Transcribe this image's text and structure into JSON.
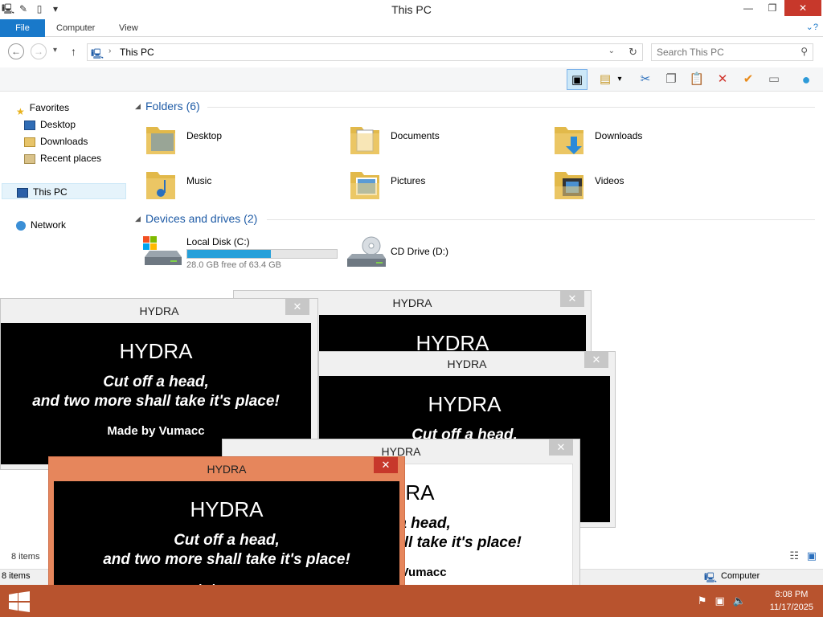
{
  "window": {
    "title": "This PC",
    "minimize": "—",
    "restore": "❐",
    "close": "✕"
  },
  "ribbon": {
    "tabs": [
      "File",
      "Computer",
      "View"
    ],
    "help_icon": "⌄?"
  },
  "address": {
    "path": "This PC",
    "search_placeholder": "Search This PC"
  },
  "nav": {
    "favorites": "Favorites",
    "desktop": "Desktop",
    "downloads": "Downloads",
    "recent": "Recent places",
    "this_pc": "This PC",
    "network": "Network"
  },
  "folders": {
    "heading": "Folders (6)",
    "items": [
      "Desktop",
      "Documents",
      "Downloads",
      "Music",
      "Pictures",
      "Videos"
    ]
  },
  "drives": {
    "heading": "Devices and drives (2)",
    "local": {
      "name": "Local Disk (C:)",
      "free": "28.0 GB free of 63.4 GB",
      "used_fraction": 0.56
    },
    "cd": {
      "name": "CD Drive (D:)"
    }
  },
  "status": {
    "items_count": "8 items",
    "items_count2": "8 items",
    "zone": "Computer"
  },
  "taskbar": {
    "time": "8:08 PM",
    "date": "11/17/2025"
  },
  "popup": {
    "title": "HYDRA",
    "heading": "HYDRA",
    "line1": "Cut off a head,",
    "line2": "and two more shall take it's place!",
    "credit": "Made by Vumacc",
    "close": "✕"
  }
}
